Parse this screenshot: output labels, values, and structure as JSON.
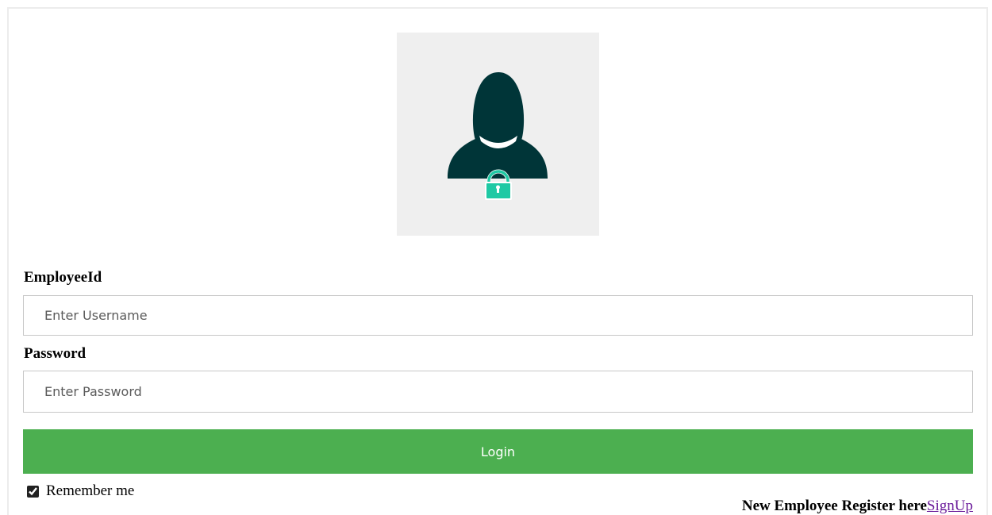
{
  "login_form": {
    "employee_id_label": "EmployeeId",
    "username_placeholder": "Enter Username",
    "password_label": "Password",
    "password_placeholder": "Enter Password",
    "login_button_label": "Login",
    "remember_label": "Remember me",
    "remember_checked": true,
    "register_text": "New Employee Register here",
    "signup_link_label": "SignUp"
  },
  "avatar": {
    "icon": "user-lock-icon",
    "figure_color": "#003538",
    "lock_color": "#1fc9a4",
    "background_color": "#efefef"
  },
  "colors": {
    "login_button": "#4caf50",
    "signup_link": "#6a1a9a"
  }
}
